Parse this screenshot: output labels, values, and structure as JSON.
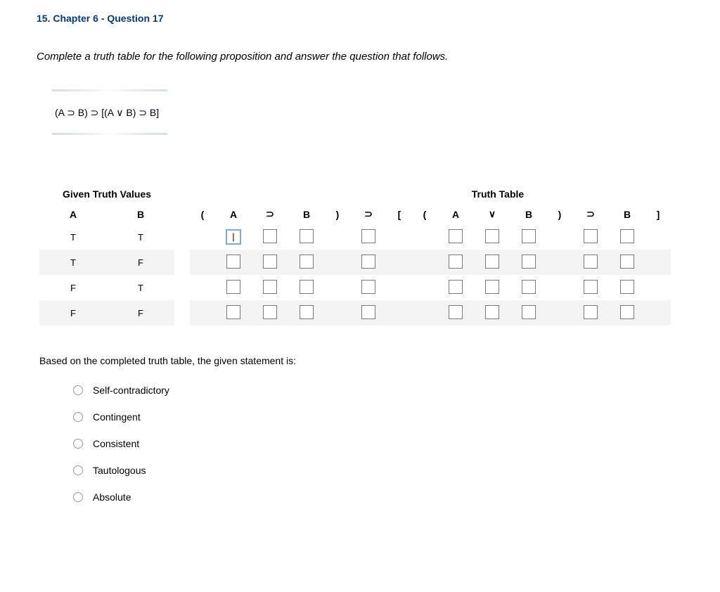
{
  "title": "15. Chapter 6 - Question 17",
  "instructions": "Complete a truth table for the following proposition and answer the question that follows.",
  "proposition": "(A ⊃ B) ⊃ [(A ∨ B) ⊃ B]",
  "table": {
    "given_header": "Given Truth Values",
    "truth_header": "Truth Table",
    "cols": {
      "A": "A",
      "B": "B",
      "lp": "(",
      "sup": "⊃",
      "rp": ")",
      "lb": "[",
      "or": "∨",
      "rb": "]"
    },
    "rows": [
      {
        "A": "T",
        "B": "T"
      },
      {
        "A": "T",
        "B": "F"
      },
      {
        "A": "F",
        "B": "T"
      },
      {
        "A": "F",
        "B": "F"
      }
    ],
    "focused_value": "|"
  },
  "follow_q": "Based on the completed truth table, the given statement is:",
  "options": [
    "Self-contradictory",
    "Contingent",
    "Consistent",
    "Tautologous",
    "Absolute"
  ]
}
